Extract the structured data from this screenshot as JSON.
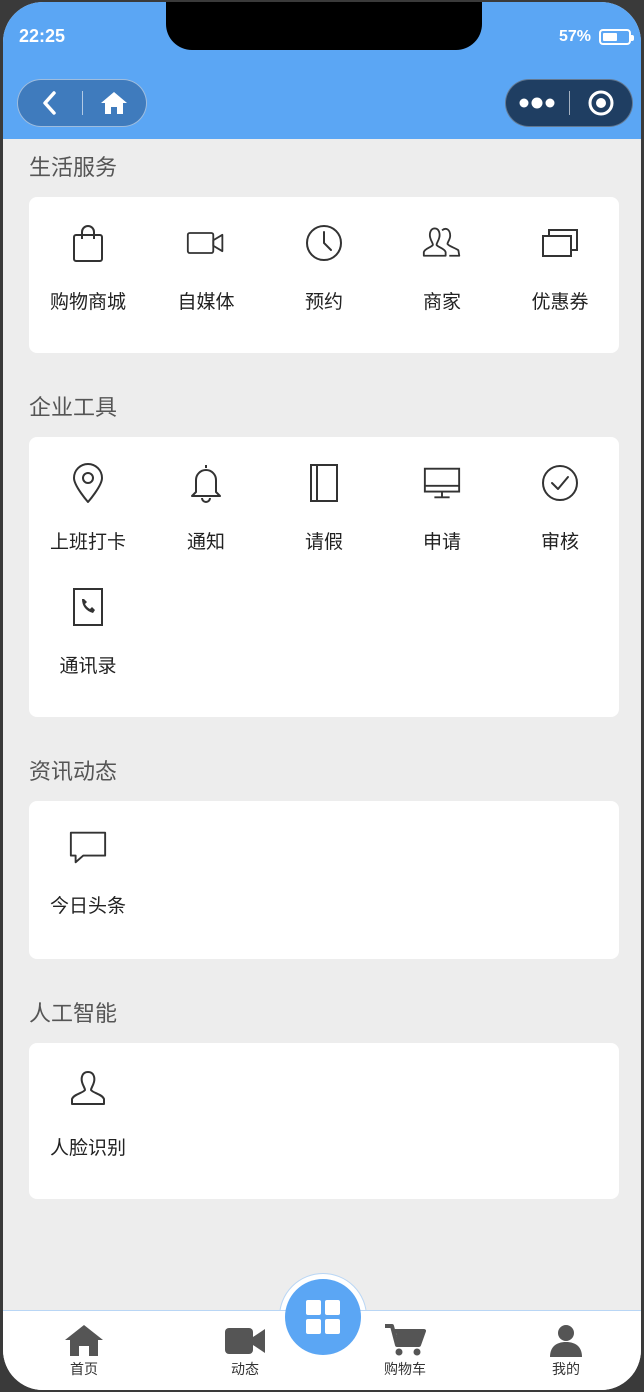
{
  "status_bar": {
    "time": "22:25",
    "battery": "57%",
    "battery_level": 0.57
  },
  "sections": [
    {
      "title": "生活服务",
      "items": [
        {
          "label": "购物商城",
          "icon": "shopping-bag-icon"
        },
        {
          "label": "自媒体",
          "icon": "video-camera-icon"
        },
        {
          "label": "预约",
          "icon": "clock-icon"
        },
        {
          "label": "商家",
          "icon": "users-icon"
        },
        {
          "label": "优惠券",
          "icon": "coupon-icon"
        }
      ]
    },
    {
      "title": "企业工具",
      "items": [
        {
          "label": "上班打卡",
          "icon": "location-pin-icon"
        },
        {
          "label": "通知",
          "icon": "bell-icon"
        },
        {
          "label": "请假",
          "icon": "book-icon"
        },
        {
          "label": "申请",
          "icon": "monitor-icon"
        },
        {
          "label": "审核",
          "icon": "check-circle-icon"
        },
        {
          "label": "通讯录",
          "icon": "phone-contact-icon"
        }
      ]
    },
    {
      "title": "资讯动态",
      "items": [
        {
          "label": "今日头条",
          "icon": "chat-bubble-icon"
        }
      ]
    },
    {
      "title": "人工智能",
      "items": [
        {
          "label": "人脸识别",
          "icon": "person-icon"
        }
      ]
    }
  ],
  "tabbar": {
    "items": [
      {
        "label": "首页",
        "icon": "home-icon"
      },
      {
        "label": "动态",
        "icon": "video-icon"
      },
      {
        "label": "购物车",
        "icon": "cart-icon"
      },
      {
        "label": "我的",
        "icon": "user-icon"
      }
    ],
    "center_icon": "grid-icon"
  },
  "colors": {
    "primary": "#5ba6f4",
    "background": "#ededed",
    "card": "#ffffff"
  }
}
